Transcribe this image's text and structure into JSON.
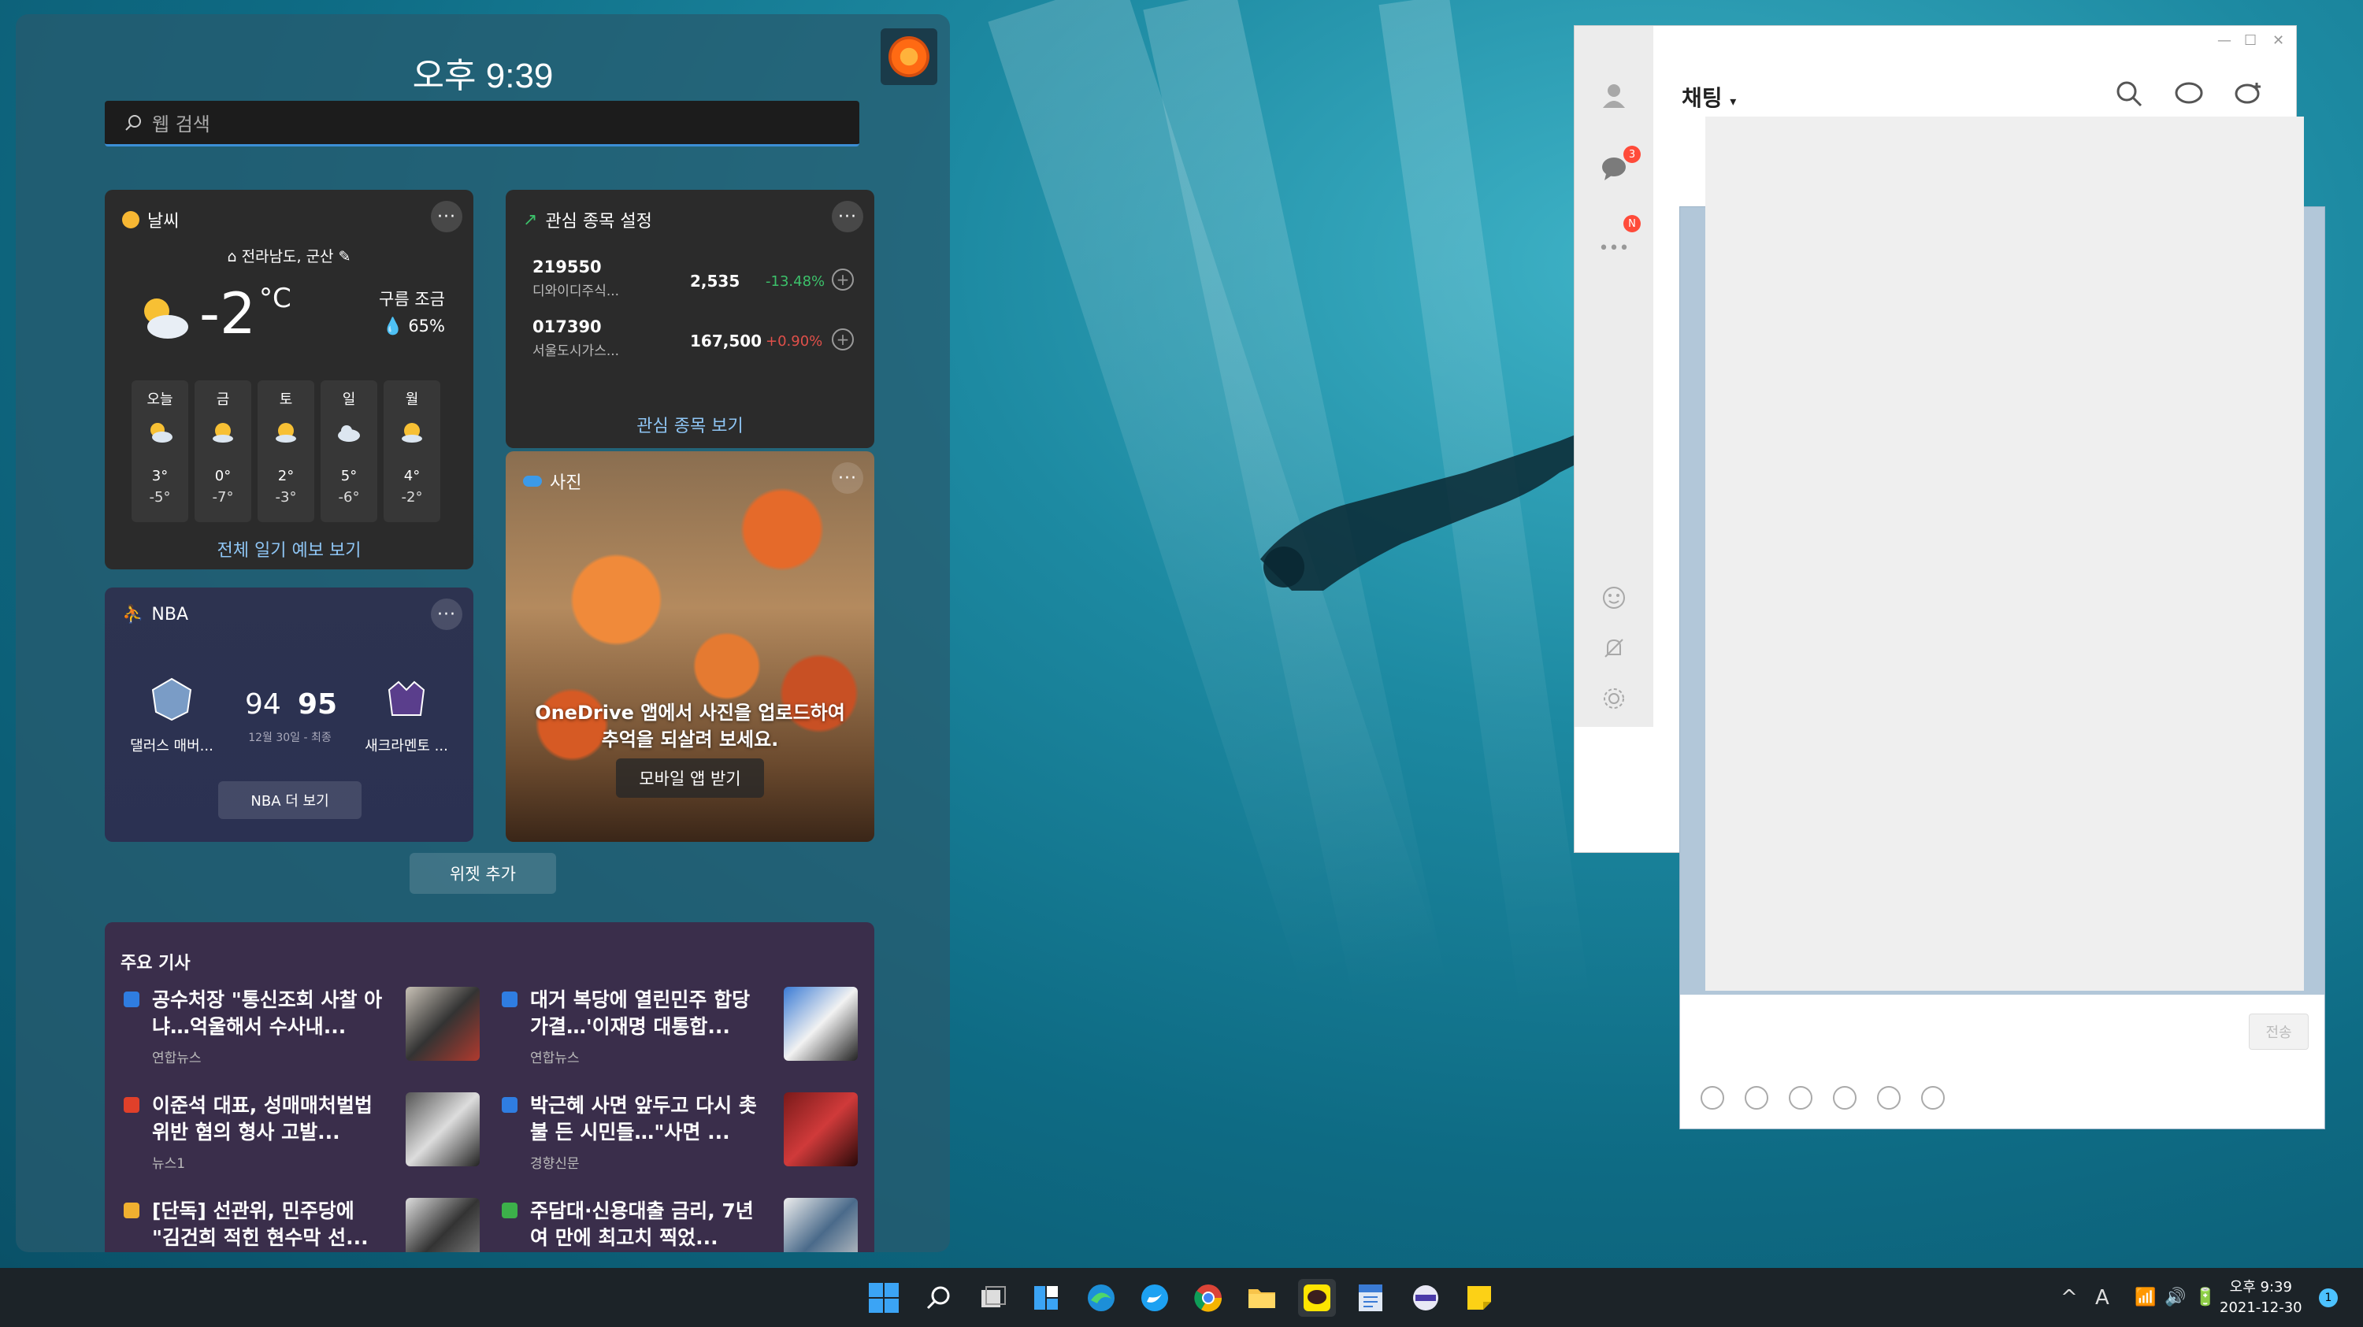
{
  "widgets": {
    "time": "오후 9:39",
    "search_placeholder": "웹 검색",
    "weather": {
      "title": "날씨",
      "location": "전라남도, 군산",
      "temp": "-2",
      "unit": "°C",
      "condition": "구름 조금",
      "humidity": "65%",
      "forecast": [
        {
          "day": "오늘",
          "hi": "3°",
          "lo": "-5°",
          "icon": "cloud-sun-icon"
        },
        {
          "day": "금",
          "hi": "0°",
          "lo": "-7°",
          "icon": "sun-cloud-icon"
        },
        {
          "day": "토",
          "hi": "2°",
          "lo": "-3°",
          "icon": "sun-cloud-icon"
        },
        {
          "day": "일",
          "hi": "5°",
          "lo": "-6°",
          "icon": "cloud-icon"
        },
        {
          "day": "월",
          "hi": "4°",
          "lo": "-2°",
          "icon": "sun-cloud-icon"
        }
      ],
      "link": "전체 일기 예보 보기"
    },
    "stocks": {
      "title": "관심 종목 설정",
      "items": [
        {
          "code": "219550",
          "name": "디와이디주식...",
          "price": "2,535",
          "change": "-13.48%",
          "change_color": "#3cc06a"
        },
        {
          "code": "017390",
          "name": "서울도시가스...",
          "price": "167,500",
          "change": "+0.90%",
          "change_color": "#e0504a"
        }
      ],
      "link": "관심 종목 보기"
    },
    "photos": {
      "title": "사진",
      "message": "OneDrive 앱에서 사진을 업로드하여 추억을 되살려 보세요.",
      "button": "모바일 앱 받기"
    },
    "nba": {
      "title": "NBA",
      "home_team": "댈러스 매버...",
      "home_score": "94",
      "away_team": "새크라멘토 ...",
      "away_score": "95",
      "date": "12월 30일 - 최종",
      "link": "NBA 더 보기"
    },
    "add_widget": "위젯 추가",
    "news": {
      "title": "주요 기사",
      "stories": [
        {
          "title": "공수처장 \"통신조회 사찰 아냐…억울해서 수사내...",
          "source": "연합뉴스",
          "icon_color": "#2f7de1"
        },
        {
          "title": "대거 복당에 열린민주 합당 가결…'이재명 대통합...",
          "source": "연합뉴스",
          "icon_color": "#2f7de1"
        },
        {
          "title": "이준석 대표, 성매매처벌법 위반 혐의 형사 고발...",
          "source": "뉴스1",
          "icon_color": "#e0402a"
        },
        {
          "title": "박근혜 사면 앞두고 다시 촛불 든 시민들…\"사면 ...",
          "source": "경향신문",
          "icon_color": "#2f7de1"
        },
        {
          "title": "[단독] 선관위, 민주당에 \"김건희 적힌 현수막 선...",
          "source": "",
          "icon_color": "#f0b030"
        },
        {
          "title": "주담대·신용대출 금리, 7년 여 만에 최고치 찍었...",
          "source": "",
          "icon_color": "#3cb04a"
        }
      ]
    }
  },
  "kakao": {
    "title": "채팅",
    "chat_badge": "3",
    "more_badge": "N",
    "send_button": "전송"
  },
  "taskbar": {
    "time": "오후 9:39",
    "date": "2021-12-30",
    "ime": "A",
    "notifications": "1"
  }
}
